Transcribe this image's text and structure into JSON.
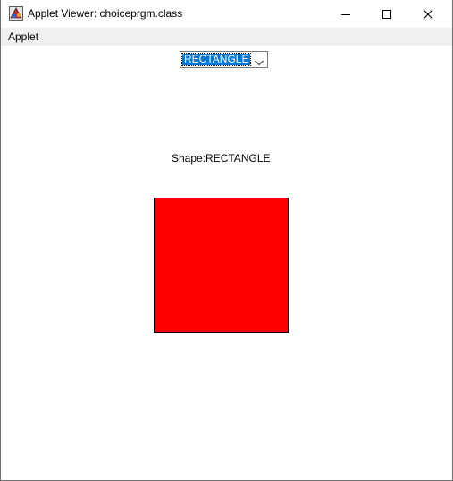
{
  "window": {
    "title": "Applet Viewer: choiceprgm.class",
    "icon": "java-applet-icon",
    "controls": {
      "minimize_icon": "minimize-icon",
      "maximize_icon": "maximize-icon",
      "close_icon": "close-icon"
    }
  },
  "menubar": {
    "items": [
      {
        "label": "Applet"
      }
    ]
  },
  "applet": {
    "choice": {
      "selected": "RECTANGLE",
      "arrow_icon": "chevron-down-icon"
    },
    "shape_label": "Shape:RECTANGLE",
    "shape": {
      "type": "rectangle",
      "fill_color": "#ff0000",
      "border_color": "#000000"
    }
  },
  "colors": {
    "selection_highlight": "#0078d7",
    "menubar_background": "#f0f0f0",
    "content_background": "#ffffff"
  }
}
